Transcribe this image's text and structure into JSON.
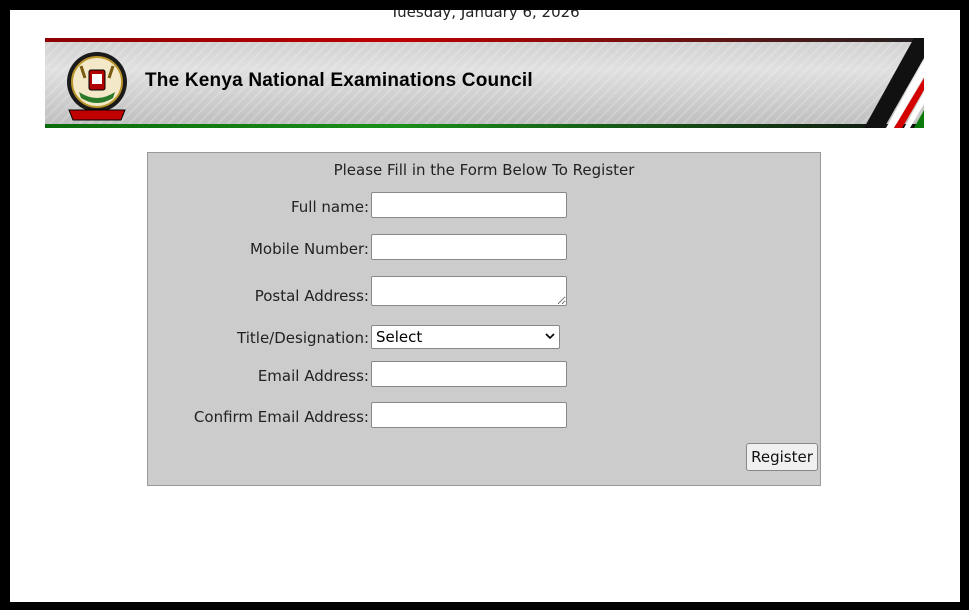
{
  "header": {
    "date": "Tuesday, January 6, 2026",
    "title": "The Kenya National Examinations Council",
    "logo_icon": "coat-of-arms-icon",
    "flag_icon": "kenya-flag-stripes-icon"
  },
  "form": {
    "heading": "Please Fill in the Form Below To Register",
    "fields": {
      "full_name": {
        "label": "Full name:",
        "value": ""
      },
      "mobile": {
        "label": "Mobile Number:",
        "value": ""
      },
      "postal": {
        "label": "Postal Address:",
        "value": ""
      },
      "title": {
        "label": "Title/Designation:",
        "selected": "Select"
      },
      "email": {
        "label": "Email Address:",
        "value": ""
      },
      "confirm_email": {
        "label": "Confirm Email Address:",
        "value": ""
      }
    },
    "submit_label": "Register"
  },
  "colors": {
    "panel_bg": "#cccccc",
    "kenya_red": "#c00000",
    "kenya_green": "#0a7a0a",
    "kenya_black": "#000000"
  }
}
